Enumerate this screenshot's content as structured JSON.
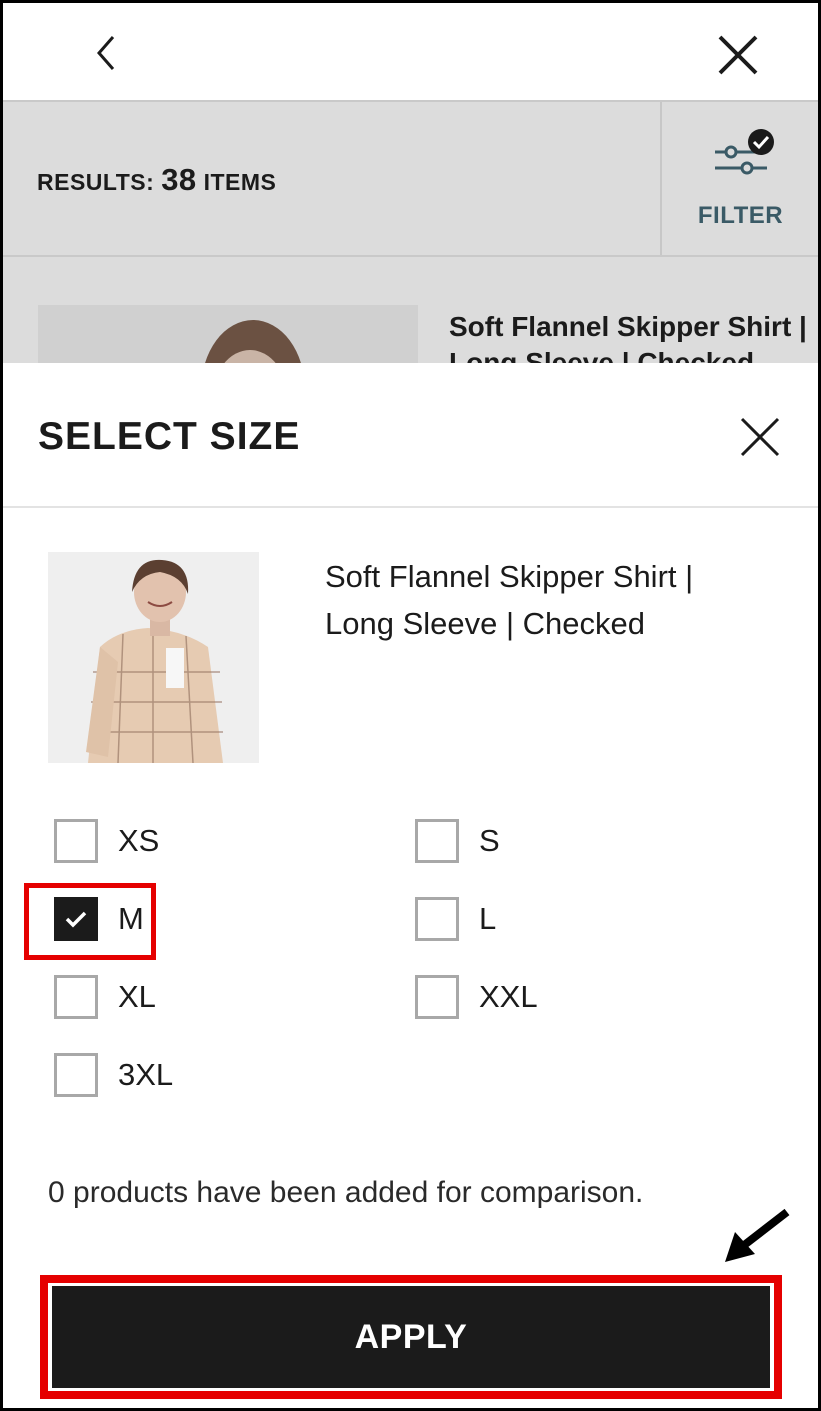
{
  "results_bar": {
    "results_prefix": "RESULTS:",
    "results_count": "38",
    "results_suffix": "ITEMS",
    "filter_label": "FILTER"
  },
  "product_list": {
    "first_item_title": "Soft Flannel Skipper Shirt | Long Sleeve | Checked"
  },
  "sheet": {
    "title": "SELECT SIZE",
    "product_name": "Soft Flannel Skipper Shirt | Long Sleeve | Checked",
    "sizes": [
      {
        "label": "XS",
        "checked": false
      },
      {
        "label": "S",
        "checked": false
      },
      {
        "label": "M",
        "checked": true
      },
      {
        "label": "L",
        "checked": false
      },
      {
        "label": "XL",
        "checked": false
      },
      {
        "label": "XXL",
        "checked": false
      },
      {
        "label": "3XL",
        "checked": false
      }
    ],
    "compare_text": "0 products have been added for comparison.",
    "apply_label": "APPLY"
  },
  "colors": {
    "highlight": "#e50000",
    "filter_accent": "#3a5a66",
    "button_bg": "#1b1b1b",
    "dimmed_bg": "#dcdcdc"
  },
  "icons": [
    "back-chevron-icon",
    "close-icon",
    "filter-sliders-icon",
    "check-icon",
    "arrow-pointer-icon"
  ]
}
